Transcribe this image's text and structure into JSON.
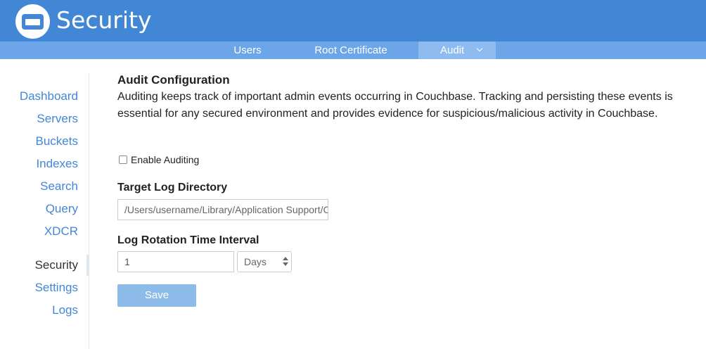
{
  "app": {
    "title": "Security"
  },
  "tabs": [
    {
      "label": "Users",
      "active": false
    },
    {
      "label": "Root Certificate",
      "active": false
    },
    {
      "label": "Audit",
      "active": true
    }
  ],
  "sidebar": {
    "items": [
      {
        "label": "Dashboard"
      },
      {
        "label": "Servers"
      },
      {
        "label": "Buckets"
      },
      {
        "label": "Indexes"
      },
      {
        "label": "Search"
      },
      {
        "label": "Query"
      },
      {
        "label": "XDCR"
      },
      {
        "label": "Security",
        "active": true
      },
      {
        "label": "Settings"
      },
      {
        "label": "Logs"
      }
    ]
  },
  "audit": {
    "title": "Audit Configuration",
    "description": "Auditing keeps track of important admin events occurring in Couchbase. Tracking and persisting these events is essential for any secured environment and provides evidence for suspicious/malicious activity in Couchbase.",
    "enable_label": "Enable Auditing",
    "enable_checked": false,
    "log_dir_label": "Target Log Directory",
    "log_dir_value": "/Users/username/Library/Application Support/Couchbase/var/lib/couchbase/logs",
    "rotation_label": "Log Rotation Time Interval",
    "rotation_value": "1",
    "rotation_unit": "Days",
    "save_label": "Save"
  },
  "colors": {
    "header": "#4287d6",
    "tabbar": "#6ca6e8",
    "active_tab": "#8ebcf0",
    "link": "#4287d6",
    "save_button": "#8ebcea"
  },
  "icons": {
    "logo": "couchbase-logo-icon",
    "tab_dropdown": "chevron-down-icon",
    "select_arrows": "up-down-arrows-icon"
  }
}
